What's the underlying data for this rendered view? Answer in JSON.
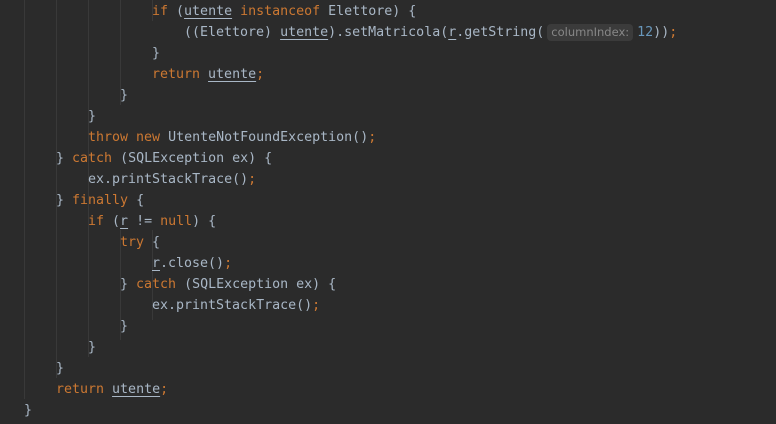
{
  "colors": {
    "background": "#2b2b2b",
    "keyword": "#cc7832",
    "text": "#a9b7c6",
    "number": "#6897bb",
    "hint_bg": "#3b3b3b",
    "hint_text": "#878787"
  },
  "lines": [
    {
      "indent": 4,
      "tokens": [
        [
          "kw",
          "if "
        ],
        [
          "punc",
          "("
        ],
        [
          "var",
          "utente"
        ],
        [
          "kw",
          " instanceof "
        ],
        [
          "punc",
          "Elettore) {"
        ]
      ]
    },
    {
      "indent": 5,
      "tokens": [
        [
          "punc",
          "((Elettore) "
        ],
        [
          "var",
          "utente"
        ],
        [
          "punc",
          ").setMatricola("
        ],
        [
          "var",
          "r"
        ],
        [
          "punc",
          ".getString("
        ],
        [
          "hint",
          "columnIndex:"
        ],
        [
          "num",
          "12"
        ],
        [
          "punc",
          "))"
        ],
        [
          "semi",
          ";"
        ]
      ]
    },
    {
      "indent": 4,
      "tokens": [
        [
          "punc",
          "}"
        ]
      ]
    },
    {
      "indent": 4,
      "tokens": [
        [
          "kw",
          "return "
        ],
        [
          "var",
          "utente"
        ],
        [
          "semi",
          ";"
        ]
      ]
    },
    {
      "indent": 3,
      "tokens": [
        [
          "punc",
          "}"
        ]
      ]
    },
    {
      "indent": 2,
      "tokens": [
        [
          "punc",
          "}"
        ]
      ]
    },
    {
      "indent": 2,
      "tokens": [
        [
          "kw",
          "throw new "
        ],
        [
          "punc",
          "UtenteNotFoundException()"
        ],
        [
          "semi",
          ";"
        ]
      ]
    },
    {
      "indent": 1,
      "tokens": [
        [
          "punc",
          "} "
        ],
        [
          "kw",
          "catch "
        ],
        [
          "punc",
          "(SQLException ex) {"
        ]
      ]
    },
    {
      "indent": 2,
      "tokens": [
        [
          "punc",
          "ex.printStackTrace()"
        ],
        [
          "semi",
          ";"
        ]
      ]
    },
    {
      "indent": 1,
      "tokens": [
        [
          "punc",
          "} "
        ],
        [
          "kw",
          "finally "
        ],
        [
          "punc",
          "{"
        ]
      ]
    },
    {
      "indent": 2,
      "tokens": [
        [
          "kw",
          "if "
        ],
        [
          "punc",
          "("
        ],
        [
          "var",
          "r"
        ],
        [
          "punc",
          " != "
        ],
        [
          "kw",
          "null"
        ],
        [
          "punc",
          ") {"
        ]
      ]
    },
    {
      "indent": 3,
      "tokens": [
        [
          "kw",
          "try "
        ],
        [
          "punc",
          "{"
        ]
      ]
    },
    {
      "indent": 4,
      "tokens": [
        [
          "var",
          "r"
        ],
        [
          "punc",
          ".close()"
        ],
        [
          "semi",
          ";"
        ]
      ]
    },
    {
      "indent": 3,
      "tokens": [
        [
          "punc",
          "} "
        ],
        [
          "kw",
          "catch "
        ],
        [
          "punc",
          "(SQLException ex) {"
        ]
      ]
    },
    {
      "indent": 4,
      "tokens": [
        [
          "punc",
          "ex.printStackTrace()"
        ],
        [
          "semi",
          ";"
        ]
      ]
    },
    {
      "indent": 3,
      "tokens": [
        [
          "punc",
          "}"
        ]
      ]
    },
    {
      "indent": 2,
      "tokens": [
        [
          "punc",
          "}"
        ]
      ]
    },
    {
      "indent": 1,
      "tokens": [
        [
          "punc",
          "}"
        ]
      ]
    },
    {
      "indent": 1,
      "tokens": [
        [
          "kw",
          "return "
        ],
        [
          "var",
          "utente"
        ],
        [
          "semi",
          ";"
        ]
      ]
    },
    {
      "indent": 0,
      "tokens": [
        [
          "punc",
          "}"
        ]
      ]
    }
  ]
}
